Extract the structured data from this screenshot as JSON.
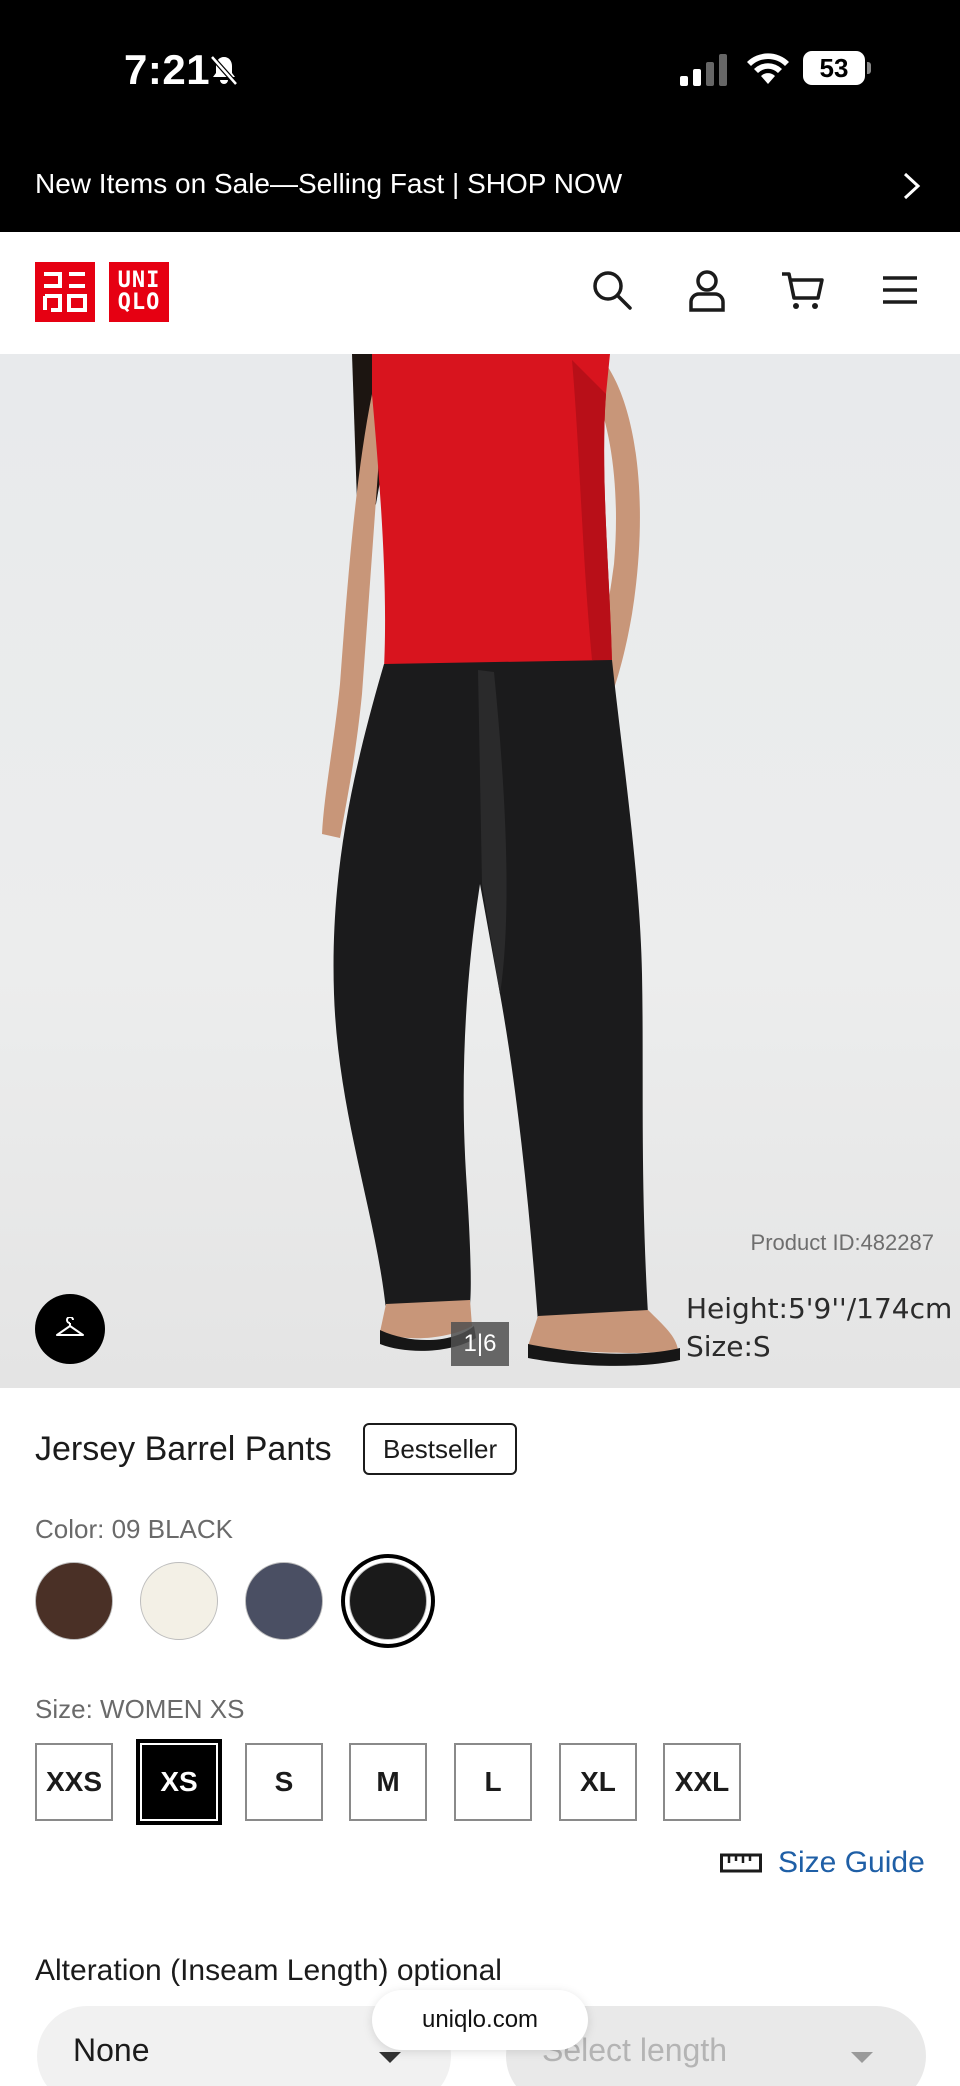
{
  "status_bar": {
    "time": "7:21",
    "battery": "53",
    "icons": [
      "bell-off-icon",
      "signal-icon",
      "wifi-icon",
      "battery-icon"
    ]
  },
  "promo": {
    "text": "New Items on Sale—Selling Fast | SHOP NOW"
  },
  "header": {
    "logo_kana": "ユニ\nクロ",
    "logo_latin_top": "UNI",
    "logo_latin_bottom": "QLO",
    "brand_color": "#e60012",
    "icons": [
      "search-icon",
      "account-icon",
      "cart-icon",
      "menu-icon"
    ]
  },
  "hero": {
    "product_id": "Product ID:482287",
    "model_height": "Height:5'9''/174cm",
    "model_size": "Size:S",
    "image_counter": "1|6"
  },
  "product": {
    "title": "Jersey Barrel Pants",
    "badge": "Bestseller",
    "color_label": "Color: 09 BLACK",
    "colors": [
      {
        "name": "brown",
        "hex": "#4a3026",
        "selected": false
      },
      {
        "name": "off-white",
        "hex": "#f3f0e6",
        "selected": false
      },
      {
        "name": "navy-gray",
        "hex": "#4a4f63",
        "selected": false
      },
      {
        "name": "black",
        "hex": "#1a1a1a",
        "selected": true
      }
    ],
    "size_label": "Size: WOMEN XS",
    "sizes": [
      {
        "label": "XXS",
        "selected": false
      },
      {
        "label": "XS",
        "selected": true
      },
      {
        "label": "S",
        "selected": false
      },
      {
        "label": "M",
        "selected": false
      },
      {
        "label": "L",
        "selected": false
      },
      {
        "label": "XL",
        "selected": false
      },
      {
        "label": "XXL",
        "selected": false
      }
    ],
    "size_guide": "Size Guide",
    "alteration_label": "Alteration (Inseam Length) optional",
    "alteration_select": "None",
    "length_placeholder": "Select length"
  },
  "browser": {
    "url": "uniqlo.com"
  }
}
